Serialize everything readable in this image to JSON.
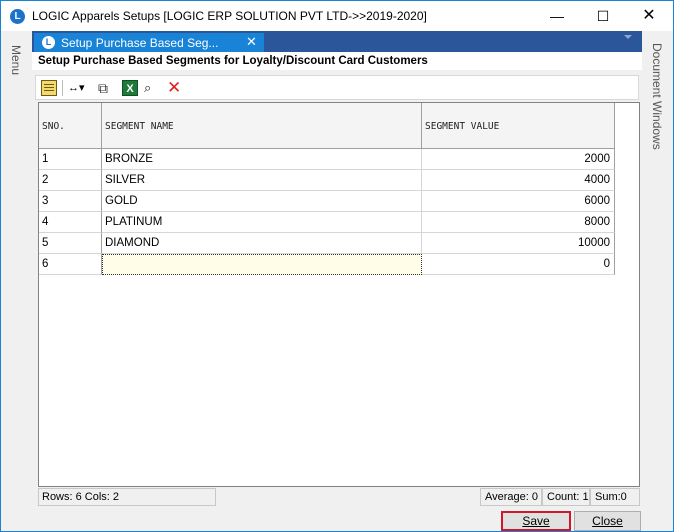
{
  "window": {
    "app_icon": "L",
    "title": "LOGIC Apparels Setups  [LOGIC ERP SOLUTION PVT LTD->>2019-2020]",
    "min_glyph": "—",
    "max_glyph": "☐",
    "close_glyph": "✕"
  },
  "side": {
    "left_label": "Menu",
    "right_label": "Document Windows"
  },
  "tab": {
    "icon": "L",
    "label": "Setup Purchase Based Seg...",
    "close_glyph": "✕"
  },
  "heading": "Setup Purchase Based Segments for Loyalty/Discount Card Customers",
  "toolbar": {
    "cols_glyph": "↔▾",
    "copy_glyph": "⧉",
    "excel_glyph": "X",
    "find_glyph": "⌕",
    "delete_glyph": "✕",
    "icons": [
      "note-icon",
      "column-width-icon",
      "copy-icon",
      "excel-export-icon",
      "find-icon",
      "delete-icon"
    ]
  },
  "grid": {
    "columns": [
      "SNO.",
      "SEGMENT NAME",
      "SEGMENT VALUE"
    ],
    "rows": [
      {
        "sno": "1",
        "name": "BRONZE",
        "value": "2000"
      },
      {
        "sno": "2",
        "name": "SILVER",
        "value": "4000"
      },
      {
        "sno": "3",
        "name": "GOLD",
        "value": "6000"
      },
      {
        "sno": "4",
        "name": "PLATINUM",
        "value": "8000"
      },
      {
        "sno": "5",
        "name": "DIAMOND",
        "value": "10000"
      },
      {
        "sno": "6",
        "name": "",
        "value": "0"
      }
    ]
  },
  "status": {
    "rows_cols": "Rows: 6  Cols: 2",
    "average": "Average: 0",
    "count": "Count: 1",
    "sum": "Sum:0"
  },
  "buttons": {
    "save": "Save",
    "close": "Close"
  },
  "colors": {
    "accent": "#1883d7",
    "tabstrip": "#2b579a",
    "save_border": "#d0182b"
  }
}
